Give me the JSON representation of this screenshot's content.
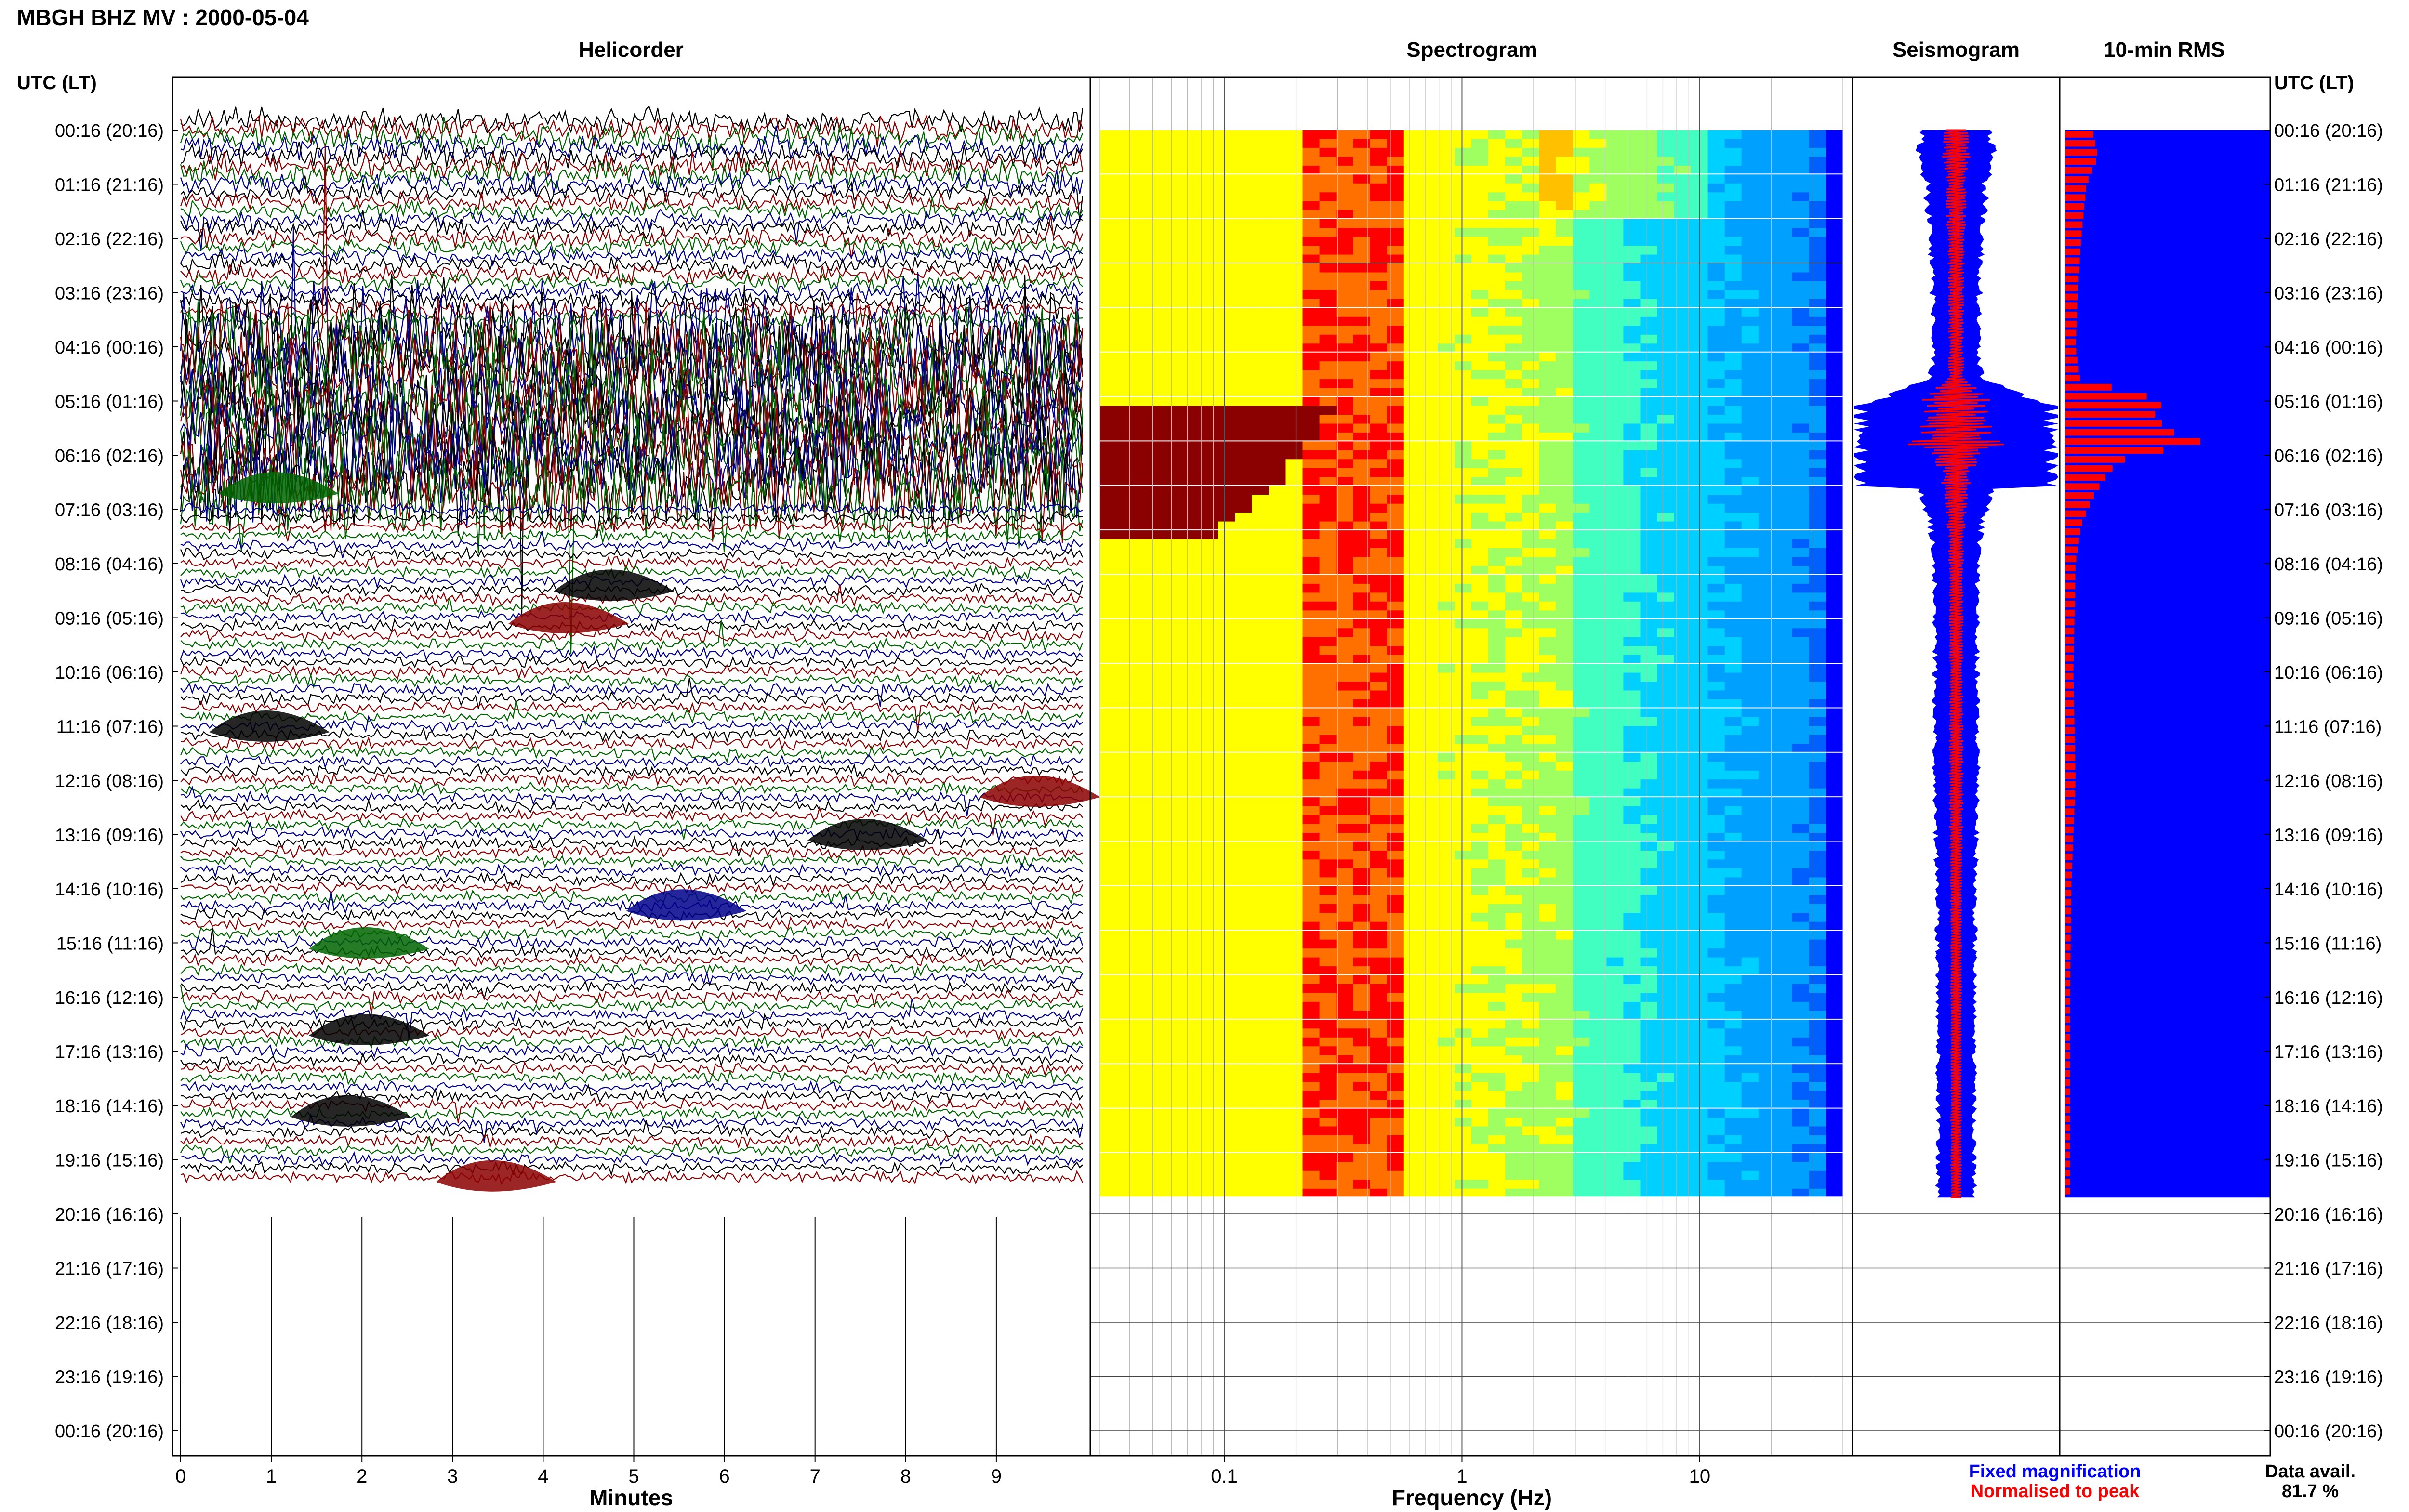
{
  "page_title": "MBGH BHZ MV : 2000-05-04",
  "axis_header_left": "UTC (LT)",
  "axis_header_right": "UTC (LT)",
  "panels": {
    "helicorder": "Helicorder",
    "spectrogram": "Spectrogram",
    "seismogram": "Seismogram",
    "rms": "10-min RMS"
  },
  "legend": {
    "fixed": "Fixed magnification",
    "normalised": "Normalised to peak",
    "fixed_color": "#0000ff",
    "normalised_color": "#ff0000"
  },
  "data_avail": {
    "label": "Data avail.",
    "value": "81.7 %"
  },
  "colors": {
    "trace_cycle": [
      "#000000",
      "#8b0000",
      "#006400",
      "#00008b"
    ],
    "frame": "#000000",
    "rms_bar": "#0000ff",
    "rms_peak": "#ff0000"
  },
  "chart_data": [
    {
      "type": "line",
      "name": "helicorder",
      "title": "Helicorder",
      "xlabel": "Minutes",
      "x_ticks": [
        "0",
        "1",
        "2",
        "3",
        "4",
        "5",
        "6",
        "7",
        "8",
        "9"
      ],
      "xlim": [
        0,
        10
      ],
      "row_labels": [
        "00:16 (20:16)",
        "01:16 (21:16)",
        "02:16 (22:16)",
        "03:16 (23:16)",
        "04:16 (00:16)",
        "05:16 (01:16)",
        "06:16 (02:16)",
        "07:16 (03:16)",
        "08:16 (04:16)",
        "09:16 (05:16)",
        "10:16 (06:16)",
        "11:16 (07:16)",
        "12:16 (08:16)",
        "13:16 (09:16)",
        "14:16 (10:16)",
        "15:16 (11:16)",
        "16:16 (12:16)",
        "17:16 (13:16)",
        "18:16 (14:16)",
        "19:16 (15:16)",
        "20:16 (16:16)",
        "21:16 (17:16)",
        "22:16 (18:16)",
        "23:16 (19:16)",
        "00:16 (20:16)"
      ],
      "data_end_hour": 19.7,
      "activity_window_hours": [
        3.7,
        7.0
      ]
    },
    {
      "type": "heatmap",
      "name": "spectrogram",
      "title": "Spectrogram",
      "xlabel": "Frequency (Hz)",
      "x_scale": "log",
      "xlim": [
        0.03,
        40
      ],
      "x_ticks": [
        {
          "value": 0.1,
          "label": "0.1"
        },
        {
          "value": 1,
          "label": "1"
        },
        {
          "value": 10,
          "label": "10"
        }
      ],
      "peak_frequency_hz": [
        0.2,
        0.6
      ],
      "strong_low_freq_hours": [
        5.0,
        7.5
      ]
    },
    {
      "type": "line",
      "name": "seismogram",
      "title": "Seismogram",
      "series": [
        {
          "name": "Fixed magnification",
          "color": "#0000ff"
        },
        {
          "name": "Normalised to peak",
          "color": "#ff0000"
        }
      ]
    },
    {
      "type": "bar",
      "name": "rms",
      "title": "10-min RMS",
      "orientation": "horizontal",
      "data_end_hour": 19.7,
      "peak_hour": 5.8,
      "profile_hours": [
        0,
        0.5,
        1,
        2,
        3,
        4,
        4.6,
        5.0,
        5.3,
        5.6,
        5.8,
        6.0,
        6.3,
        6.8,
        7.3,
        8,
        10,
        12,
        14,
        16,
        18,
        19.7
      ],
      "profile_values": [
        0.25,
        0.3,
        0.2,
        0.15,
        0.12,
        0.1,
        0.14,
        0.9,
        0.8,
        1.0,
        1.3,
        0.6,
        0.4,
        0.25,
        0.15,
        0.1,
        0.08,
        0.1,
        0.06,
        0.05,
        0.05,
        0.05
      ]
    }
  ]
}
